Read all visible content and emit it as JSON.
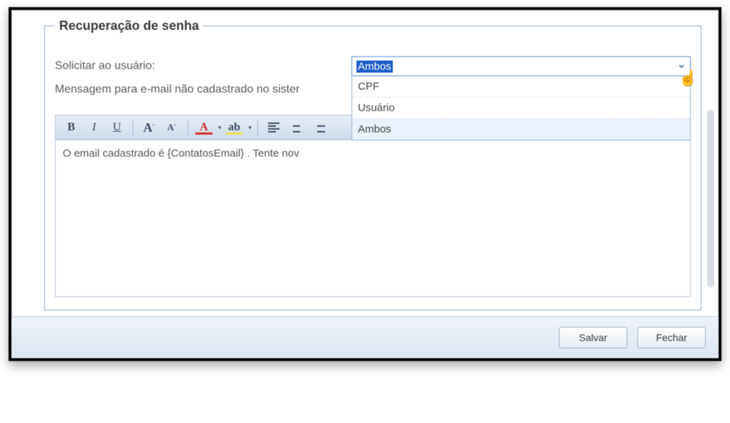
{
  "group": {
    "title": "Recuperação de senha",
    "solicitar_label": "Solicitar ao usuário:",
    "mensagem_label": "Mensagem para e-mail não cadastrado no sister"
  },
  "select": {
    "value": "Ambos",
    "options": [
      "CPF",
      "Usuário",
      "Ambos"
    ]
  },
  "toolbar": {
    "bold": "B",
    "italic": "I",
    "underline": "U",
    "font_inc": "A",
    "font_dec": "A",
    "font_sup_plus": "ˆ",
    "font_sup_minus": "ˇ",
    "font_color": "A",
    "highlight": "ab",
    "align_left": "",
    "align_center": "",
    "align_right": ""
  },
  "editor": {
    "content": "O email cadastrado é {ContatosEmail} . Tente nov"
  },
  "footer": {
    "save": "Salvar",
    "close": "Fechar"
  }
}
